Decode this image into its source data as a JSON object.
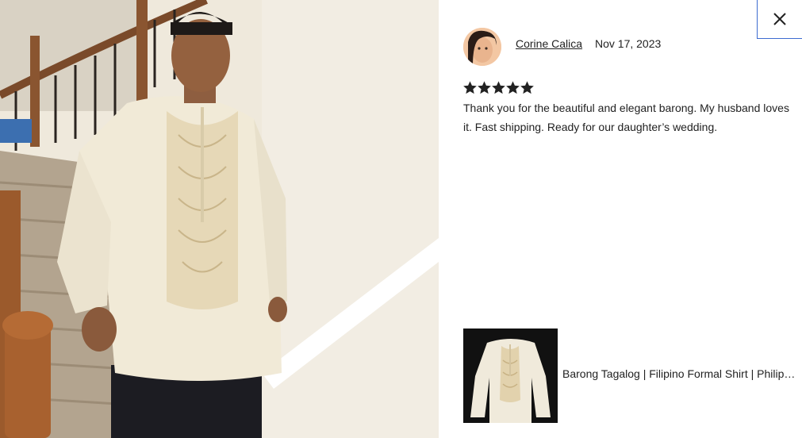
{
  "review": {
    "reviewer_name": "Corine Calica",
    "date": "Nov 17, 2023",
    "rating": 5,
    "text": "Thank you for the beautiful and elegant barong. My husband loves it. Fast shipping. Ready for our daughter’s wedding."
  },
  "product": {
    "title": "Barong Tagalog | Filipino Formal Shirt | Philippine Barong Tagalog"
  },
  "icons": {
    "close": "close-icon",
    "star": "star-icon",
    "avatar": "avatar-photo"
  },
  "colors": {
    "star": "#222222",
    "close_border": "#3d6bd1",
    "text": "#222222"
  }
}
